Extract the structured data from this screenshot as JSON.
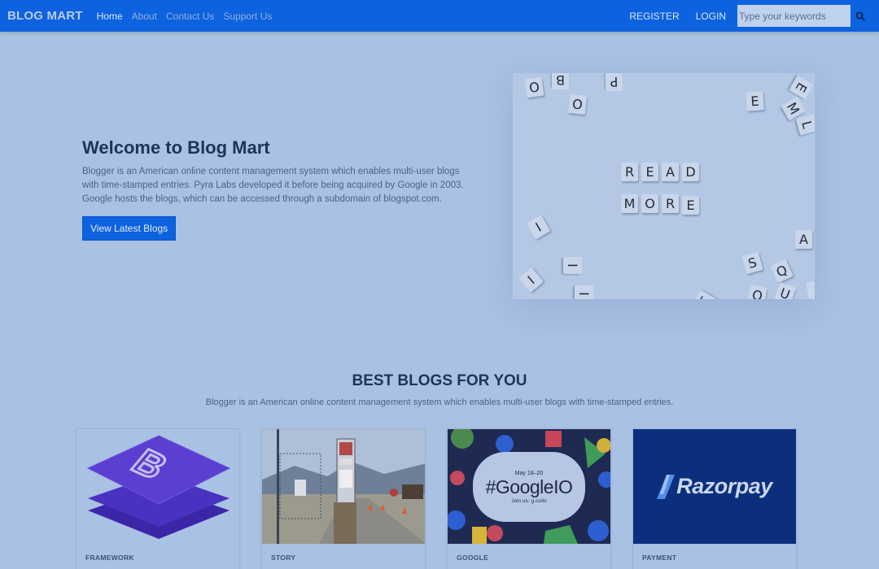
{
  "nav": {
    "brand": "BLOG MART",
    "links": [
      "Home",
      "About",
      "Contact Us",
      "Support Us"
    ],
    "register": "REGISTER",
    "login": "LOGIN",
    "search_placeholder": "Type your keywords"
  },
  "hero": {
    "title": "Welcome to Blog Mart",
    "description": "Blogger is an American online content management system which enables multi-user blogs with time-stamped entries. Pyra Labs developed it before being acquired by Google in 2003. Google hosts the blogs, which can be accessed through a subdomain of blogspot.com.",
    "button": "View Latest Blogs",
    "image_words": [
      "READ",
      "MORE"
    ]
  },
  "section": {
    "title": "BEST BLOGS FOR YOU",
    "subtitle": "Blogger is an American online content management system which enables multi-user blogs with time-stamped entries."
  },
  "cards": [
    {
      "category": "FRAMEWORK",
      "image": "bootstrap-logo"
    },
    {
      "category": "STORY",
      "image": "road-gate-photo"
    },
    {
      "category": "GOOGLE",
      "image": "google-io-banner",
      "banner_date": "May 18–20",
      "banner_title": "#GoogleIO",
      "banner_join": "Join us: g.co/io"
    },
    {
      "category": "PAYMENT",
      "image": "razorpay-logo",
      "logo_text": "Razorpay"
    }
  ],
  "colors": {
    "navbar": "#0d62df",
    "page_bg": "#a9c1e3",
    "heading": "#1d3557",
    "bootstrap_purple": "#5a3fd1",
    "razorpay_blue": "#0b2f7d"
  }
}
